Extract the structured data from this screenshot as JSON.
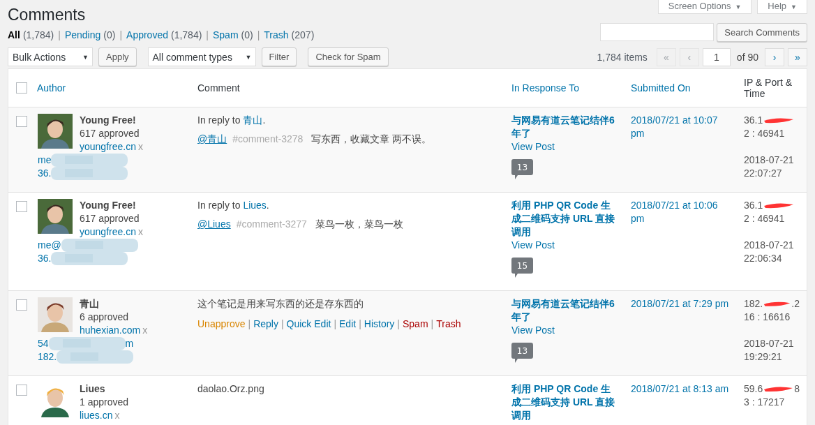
{
  "page": {
    "title": "Comments"
  },
  "header_buttons": [
    {
      "label": "Screen Options",
      "caret": "▼"
    },
    {
      "label": "Help",
      "caret": "▼"
    }
  ],
  "filters": [
    {
      "label": "All",
      "count": "(1,784)",
      "selected": true
    },
    {
      "sep": "|",
      "label": "Pending",
      "count": "(0)",
      "selected": false
    },
    {
      "sep": "|",
      "label": "Approved",
      "count": "(1,784)",
      "selected": false
    },
    {
      "sep": "|",
      "label": "Spam",
      "count": "(0)",
      "selected": false
    },
    {
      "sep": "|",
      "label": "Trash",
      "count": "(207)",
      "selected": false
    }
  ],
  "search": {
    "button": "Search Comments"
  },
  "toolbar": {
    "bulk_actions": {
      "value": "Bulk Actions",
      "caret": "▼"
    },
    "apply": "Apply",
    "comment_type": {
      "value": "All comment types",
      "caret": "▼"
    },
    "filter": "Filter",
    "check_spam": "Check for Spam"
  },
  "pagination": {
    "items": "1,784 items",
    "page": "1",
    "of": "of 90",
    "nav": [
      {
        "label": "«",
        "disabled": true
      },
      {
        "label": "‹",
        "disabled": true
      },
      {
        "label": "›",
        "disabled": false
      },
      {
        "label": "»",
        "disabled": false
      }
    ]
  },
  "table": {
    "select_all": {
      "checked": false
    },
    "columns": [
      {
        "label": "Author",
        "sortable": true
      },
      {
        "label": "Comment",
        "sortable": false
      },
      {
        "label": "In Response To",
        "sortable": true
      },
      {
        "label": "Submitted On",
        "sortable": true
      },
      {
        "label": "IP & Port & Time",
        "sortable": false
      }
    ],
    "rows": [
      {
        "checked": false,
        "author": {
          "name": "Young Free!",
          "approved": "617 approved",
          "url": "youngfree.cn",
          "remove": "x",
          "email": "me",
          "ip": "36."
        },
        "comment": {
          "reply_prefix": "In reply to ",
          "reply_to": "青山",
          "reply_suffix": ".",
          "mention": "@青山",
          "anchor": "#comment-3278",
          "text": "写东西，收藏文章 两不误。"
        },
        "response": {
          "post": "与网易有道云笔记结伴6年了",
          "view": "View Post",
          "count": "13"
        },
        "submitted": "2018/07/21 at 10:07 pm",
        "ip": {
          "start": "36.1",
          "port": "2 : 46941",
          "date": "2018-07-21",
          "time": "22:07:27"
        }
      },
      {
        "checked": false,
        "author": {
          "name": "Young Free!",
          "approved": "617 approved",
          "url": "youngfree.cn",
          "remove": "x",
          "email": "me@",
          "ip": "36."
        },
        "comment": {
          "reply_prefix": "In reply to ",
          "reply_to": "Liues",
          "reply_suffix": ".",
          "mention": "@Liues",
          "anchor": "#comment-3277",
          "text": "菜鸟一枚，菜鸟一枚"
        },
        "response": {
          "post": "利用 PHP QR Code 生成二维码支持 URL 直接调用",
          "view": "View Post",
          "count": "15"
        },
        "submitted": "2018/07/21 at 10:06 pm",
        "ip": {
          "start": "36.1",
          "port": "2 : 46941",
          "date": "2018-07-21",
          "time": "22:06:34"
        }
      },
      {
        "checked": false,
        "author": {
          "name": "青山",
          "approved": "6 approved",
          "url": "huhexian.com",
          "remove": "x",
          "email": "54",
          "email_end": "m",
          "ip": "182."
        },
        "comment": {
          "text": "这个笔记是用来写东西的还是存东西的",
          "actions": [
            {
              "label": "Unapprove",
              "kind": "unapprove"
            },
            {
              "sep": "|",
              "label": "Reply",
              "kind": "normal"
            },
            {
              "sep": "|",
              "label": "Quick Edit",
              "kind": "normal"
            },
            {
              "sep": "|",
              "label": "Edit",
              "kind": "normal"
            },
            {
              "sep": "|",
              "label": "History",
              "kind": "normal"
            },
            {
              "sep": "|",
              "label": "Spam",
              "kind": "danger"
            },
            {
              "sep": "|",
              "label": "Trash",
              "kind": "danger"
            }
          ]
        },
        "response": {
          "post": "与网易有道云笔记结伴6年了",
          "view": "View Post",
          "count": "13"
        },
        "submitted": "2018/07/21 at 7:29 pm",
        "ip": {
          "start": "182.",
          "end": ".2",
          "port": "16 : 16616",
          "date": "2018-07-21",
          "time": "19:29:21"
        }
      },
      {
        "checked": false,
        "author": {
          "name": "Liues",
          "approved": "1 approved",
          "url": "liues.cn",
          "remove": "x"
        },
        "comment": {
          "text": "daolao.Orz.png"
        },
        "response": {
          "post": "利用 PHP QR Code 生成二维码支持 URL 直接调用"
        },
        "submitted": "2018/07/21 at 8:13 am",
        "ip": {
          "start": "59.6",
          "end": "8",
          "port": "3 : 17217"
        }
      }
    ]
  }
}
